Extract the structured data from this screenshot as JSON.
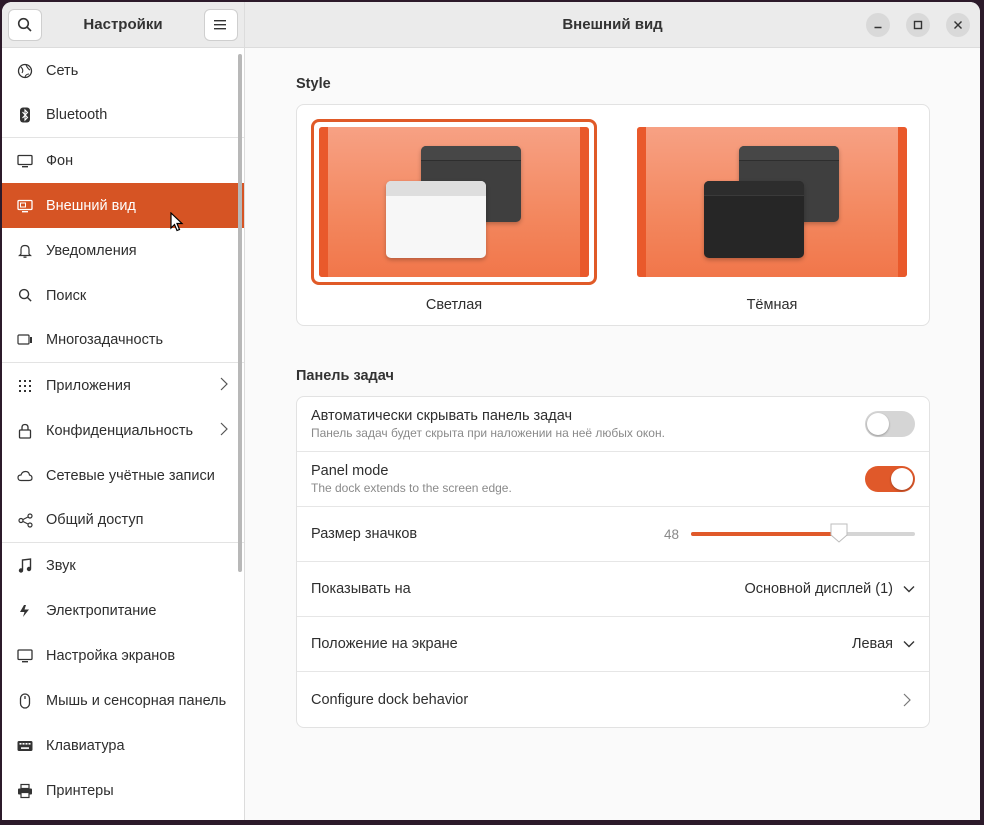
{
  "sidebar": {
    "title": "Настройки",
    "items": [
      {
        "label": "Сеть",
        "icon": "globe-icon"
      },
      {
        "label": "Bluetooth",
        "icon": "bluetooth-icon"
      },
      {
        "label": "Фон",
        "icon": "display-icon"
      },
      {
        "label": "Внешний вид",
        "icon": "appearance-icon",
        "active": true
      },
      {
        "label": "Уведомления",
        "icon": "bell-icon"
      },
      {
        "label": "Поиск",
        "icon": "search-icon"
      },
      {
        "label": "Многозадачность",
        "icon": "multitasking-icon"
      },
      {
        "label": "Приложения",
        "icon": "apps-grid-icon"
      },
      {
        "label": "Конфиденциальность",
        "icon": "lock-icon"
      },
      {
        "label": "Сетевые учётные записи",
        "icon": "cloud-icon"
      },
      {
        "label": "Общий доступ",
        "icon": "share-icon"
      },
      {
        "label": "Звук",
        "icon": "music-note-icon"
      },
      {
        "label": "Электропитание",
        "icon": "power-icon"
      },
      {
        "label": "Настройка экранов",
        "icon": "monitor-icon"
      },
      {
        "label": "Мышь и сенсорная панель",
        "icon": "mouse-icon"
      },
      {
        "label": "Клавиатура",
        "icon": "keyboard-icon"
      },
      {
        "label": "Принтеры",
        "icon": "printer-icon"
      }
    ]
  },
  "main": {
    "title": "Внешний вид",
    "style_section": {
      "title": "Style",
      "options": [
        {
          "label": "Светлая",
          "selected": true
        },
        {
          "label": "Тёмная",
          "selected": false
        }
      ]
    },
    "dock_section": {
      "title": "Панель задач",
      "autohide": {
        "title": "Автоматически скрывать панель задач",
        "subtitle": "Панель задач будет скрыта при наложении на неё любых окон.",
        "enabled": false
      },
      "panel_mode": {
        "title": "Panel mode",
        "subtitle": "The dock extends to the screen edge.",
        "enabled": true
      },
      "icon_size": {
        "title": "Размер значков",
        "value": "48",
        "fraction": 0.66
      },
      "show_on": {
        "title": "Показывать на",
        "value": "Основной дисплей (1)"
      },
      "position": {
        "title": "Положение на экране",
        "value": "Левая"
      },
      "configure": {
        "title": "Configure dock behavior"
      }
    }
  },
  "colors": {
    "accent": "#e0592a",
    "active_nav": "#d65424"
  }
}
